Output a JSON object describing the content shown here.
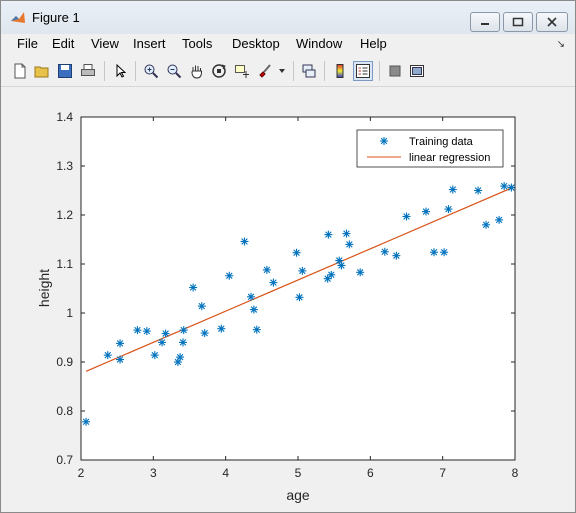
{
  "window": {
    "title": "Figure 1",
    "controls": [
      "minimize",
      "maximize",
      "close"
    ]
  },
  "menu": {
    "items": [
      "File",
      "Edit",
      "View",
      "Insert",
      "Tools",
      "Desktop",
      "Window",
      "Help"
    ]
  },
  "toolbar": {
    "icons": [
      "new-figure-icon",
      "open-file-icon",
      "save-icon",
      "print-icon",
      "select-arrow-icon",
      "zoom-in-icon",
      "zoom-out-icon",
      "pan-hand-icon",
      "rotate-3d-icon",
      "data-cursor-icon",
      "brush-icon",
      "link-plot-icon",
      "colorbar-icon",
      "legend-icon",
      "hide-plot-tools-icon",
      "show-plot-tools-icon"
    ]
  },
  "colors": {
    "series_marker": "#0072bd",
    "regression_line": "#d95319"
  },
  "chart_data": {
    "type": "scatter",
    "title": "",
    "xlabel": "age",
    "ylabel": "height",
    "xlim": [
      2,
      8
    ],
    "ylim": [
      0.7,
      1.4
    ],
    "xticks": [
      "2",
      "3",
      "4",
      "5",
      "6",
      "7",
      "8"
    ],
    "yticks": [
      "0.7",
      "0.8",
      "0.9",
      "1",
      "1.1",
      "1.2",
      "1.3",
      "1.4"
    ],
    "legend_position": "top-right",
    "series": [
      {
        "name": "Training data",
        "kind": "scatter",
        "marker": "*",
        "points": [
          [
            2.07,
            0.778
          ],
          [
            2.37,
            0.914
          ],
          [
            2.54,
            0.938
          ],
          [
            2.54,
            0.905
          ],
          [
            2.78,
            0.965
          ],
          [
            2.91,
            0.963
          ],
          [
            3.02,
            0.914
          ],
          [
            3.12,
            0.94
          ],
          [
            3.17,
            0.958
          ],
          [
            3.34,
            0.9
          ],
          [
            3.37,
            0.91
          ],
          [
            3.41,
            0.94
          ],
          [
            3.42,
            0.965
          ],
          [
            3.55,
            1.052
          ],
          [
            3.67,
            1.014
          ],
          [
            3.71,
            0.959
          ],
          [
            3.94,
            0.968
          ],
          [
            4.05,
            1.076
          ],
          [
            4.26,
            1.146
          ],
          [
            4.35,
            1.033
          ],
          [
            4.39,
            1.007
          ],
          [
            4.43,
            0.966
          ],
          [
            4.57,
            1.088
          ],
          [
            4.66,
            1.062
          ],
          [
            4.98,
            1.123
          ],
          [
            5.02,
            1.032
          ],
          [
            5.06,
            1.086
          ],
          [
            5.41,
            1.07
          ],
          [
            5.42,
            1.16
          ],
          [
            5.46,
            1.078
          ],
          [
            5.57,
            1.107
          ],
          [
            5.6,
            1.097
          ],
          [
            5.67,
            1.162
          ],
          [
            5.71,
            1.14
          ],
          [
            5.86,
            1.083
          ],
          [
            6.2,
            1.125
          ],
          [
            6.36,
            1.117
          ],
          [
            6.5,
            1.197
          ],
          [
            6.77,
            1.207
          ],
          [
            6.88,
            1.124
          ],
          [
            7.02,
            1.124
          ],
          [
            7.08,
            1.212
          ],
          [
            7.14,
            1.252
          ],
          [
            7.49,
            1.25
          ],
          [
            7.6,
            1.18
          ],
          [
            7.78,
            1.19
          ],
          [
            7.85,
            1.259
          ],
          [
            7.95,
            1.256
          ]
        ]
      },
      {
        "name": "linear regression",
        "kind": "line",
        "points": [
          [
            2.07,
            0.881
          ],
          [
            7.95,
            1.255
          ]
        ]
      }
    ]
  }
}
